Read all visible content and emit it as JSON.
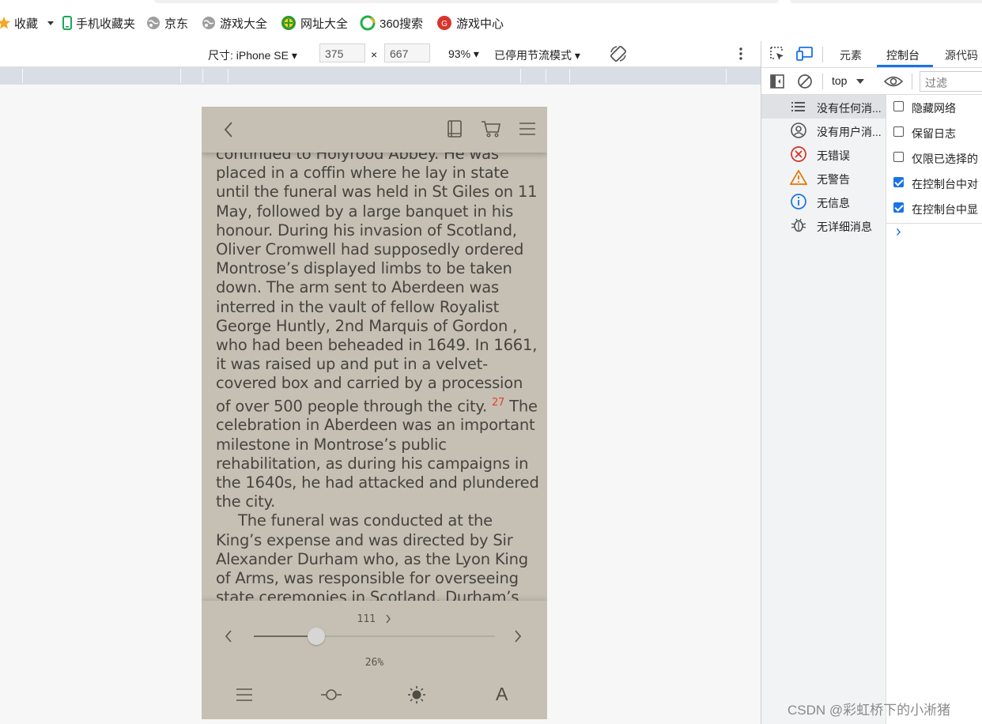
{
  "bookmarks": [
    {
      "label": "收藏",
      "icon": "star-icon"
    },
    {
      "label": "手机收藏夹",
      "icon": "phone-icon"
    },
    {
      "label": "京东",
      "icon": "globe-icon"
    },
    {
      "label": "游戏大全",
      "icon": "globe-icon"
    },
    {
      "label": "网址大全",
      "icon": "url-nav-icon"
    },
    {
      "label": "360搜索",
      "icon": "search-360-icon"
    },
    {
      "label": "游戏中心",
      "icon": "game-center-icon"
    }
  ],
  "device_toolbar": {
    "dimensions_label": "尺寸: iPhone SE ▾",
    "width": "375",
    "times": "×",
    "height": "667",
    "zoom": "93% ▾",
    "throttle": "已停用节流模式 ▾"
  },
  "reader": {
    "paragraph1": "continued to Holyrood Abbey. He was placed in a coffin where he lay in state until the funeral was held in St Giles on 11 May, followed by a large banquet in his honour. During his invasion of Scotland, Oliver Cromwell had supposedly ordered Montrose’s displayed limbs to be taken down. The arm sent to Aberdeen was interred in the vault of fellow Royalist George Huntly, 2nd Marquis of Gordon , who had been beheaded in 1649. In 1661, it was raised up and put in a velvet-covered box and carried by a procession of over 500 people through the city.",
    "footnote": "27",
    "paragraph1_end": " The celebration in Aberdeen was an important milestone in Montrose’s public rehabilitation, as during his campaigns in the 1640s, he had attacked and plundered the city.",
    "paragraph2": "The funeral was conducted at the King’s expense and was directed by Sir Alexander Durham who, as the Lyon King of Arms, was responsible for overseeing state ceremonies in Scotland. Durham’s accounts show that he distributed, at least, the enormous sum of",
    "page_number": "111",
    "progress_label": "26%",
    "progress": 0.26,
    "font_button": "A"
  },
  "devtools": {
    "tabs": [
      "元素",
      "控制台",
      "源代码"
    ],
    "active_tab": "控制台",
    "context": "top",
    "filter_placeholder": "过滤",
    "sidebar": [
      {
        "label": "没有任何消...",
        "icon": "list-icon"
      },
      {
        "label": "没有用户消...",
        "icon": "user-icon"
      },
      {
        "label": "无错误",
        "icon": "error-icon"
      },
      {
        "label": "无警告",
        "icon": "warning-icon"
      },
      {
        "label": "无信息",
        "icon": "info-icon"
      },
      {
        "label": "无详细消息",
        "icon": "bug-icon"
      }
    ],
    "settings": [
      {
        "label": "隐藏网络",
        "checked": false
      },
      {
        "label": "保留日志",
        "checked": false
      },
      {
        "label": "仅限已选择的",
        "checked": false
      },
      {
        "label": "在控制台中对",
        "checked": true
      },
      {
        "label": "在控制台中显",
        "checked": true
      }
    ],
    "prompt": "›"
  },
  "colors": {
    "reader_bg": "#c5c0b3",
    "reader_text": "#474340",
    "accent_blue": "#1a73e8",
    "error_red": "#d93025",
    "warning_orange": "#e37400"
  },
  "watermark": "CSDN @彩虹桥下的小淅猪"
}
